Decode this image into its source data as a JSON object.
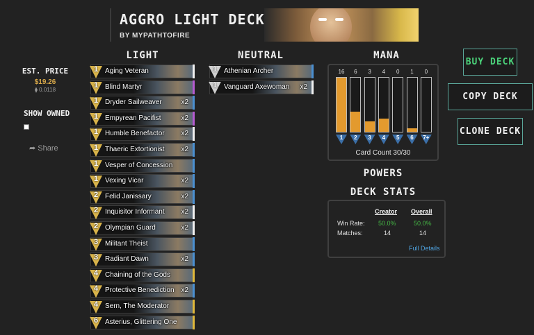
{
  "deck": {
    "title": "AGGRO LIGHT DECK",
    "author": "BY MYPATHTOFIRE"
  },
  "columns": {
    "light": "LIGHT",
    "neutral": "NEUTRAL",
    "mana": "MANA"
  },
  "price": {
    "label": "EST. PRICE",
    "usd": "$19.26",
    "eth": "⧫ 0.0118"
  },
  "owned": {
    "label": "SHOW OWNED"
  },
  "share": {
    "label": "Share"
  },
  "light_cards": [
    {
      "cost": "1",
      "name": "Aging Veteran",
      "qty": "",
      "stripe": "#f0f0f0"
    },
    {
      "cost": "1",
      "name": "Blind Martyr",
      "qty": "",
      "stripe": "#b55ad0"
    },
    {
      "cost": "1",
      "name": "Dryder Sailweaver",
      "qty": "x2",
      "stripe": "#4a8fd0"
    },
    {
      "cost": "1",
      "name": "Empyrean Pacifist",
      "qty": "x2",
      "stripe": "#b55ad0"
    },
    {
      "cost": "1",
      "name": "Humble Benefactor",
      "qty": "x2",
      "stripe": "#f0f0f0"
    },
    {
      "cost": "1",
      "name": "Thaeric Extortionist",
      "qty": "x2",
      "stripe": "#4a8fd0"
    },
    {
      "cost": "1",
      "name": "Vesper of Concession",
      "qty": "",
      "stripe": "#4a8fd0"
    },
    {
      "cost": "1",
      "name": "Vexing Vicar",
      "qty": "x2",
      "stripe": "#4a8fd0"
    },
    {
      "cost": "2",
      "name": "Felid Janissary",
      "qty": "x2",
      "stripe": "#4a8fd0"
    },
    {
      "cost": "2",
      "name": "Inquisitor Informant",
      "qty": "x2",
      "stripe": "#f0f0f0"
    },
    {
      "cost": "2",
      "name": "Olympian Guard",
      "qty": "x2",
      "stripe": "#f0f0f0"
    },
    {
      "cost": "3",
      "name": "Militant Theist",
      "qty": "",
      "stripe": "#4a8fd0"
    },
    {
      "cost": "3",
      "name": "Radiant Dawn",
      "qty": "x2",
      "stripe": "#4a8fd0"
    },
    {
      "cost": "4",
      "name": "Chaining of the Gods",
      "qty": "",
      "stripe": "#e0b83a"
    },
    {
      "cost": "4",
      "name": "Protective Benediction",
      "qty": "x2",
      "stripe": "#4a8fd0"
    },
    {
      "cost": "4",
      "name": "Sern, The Moderator",
      "qty": "",
      "stripe": "#e0b83a"
    },
    {
      "cost": "6",
      "name": "Asterius, Glittering One",
      "qty": "",
      "stripe": "#e0b83a"
    }
  ],
  "neutral_cards": [
    {
      "cost": "1",
      "name": "Athenian Archer",
      "qty": "",
      "stripe": "#4a8fd0"
    },
    {
      "cost": "1",
      "name": "Vanguard Axewoman",
      "qty": "x2",
      "stripe": "#f0f0f0"
    }
  ],
  "mana_curve": {
    "labels": [
      "1",
      "2",
      "3",
      "4",
      "5",
      "6",
      "7+"
    ],
    "counts": [
      16,
      6,
      3,
      4,
      0,
      1,
      0
    ],
    "max": 16,
    "bar_color": "#e39a2e",
    "card_count": "Card Count 30/30"
  },
  "powers": {
    "label": "POWERS"
  },
  "deck_stats": {
    "label": "DECK STATS",
    "creator_header": "Creator",
    "overall_header": "Overall",
    "win_rate_label": "Win Rate:",
    "matches_label": "Matches:",
    "creator_win_rate": "50.0%",
    "overall_win_rate": "50.0%",
    "creator_matches": "14",
    "overall_matches": "14",
    "full_details": "Full Details"
  },
  "buttons": {
    "buy": "BUY DECK",
    "copy": "COPY DECK CODE",
    "clone": "CLONE DECK"
  }
}
